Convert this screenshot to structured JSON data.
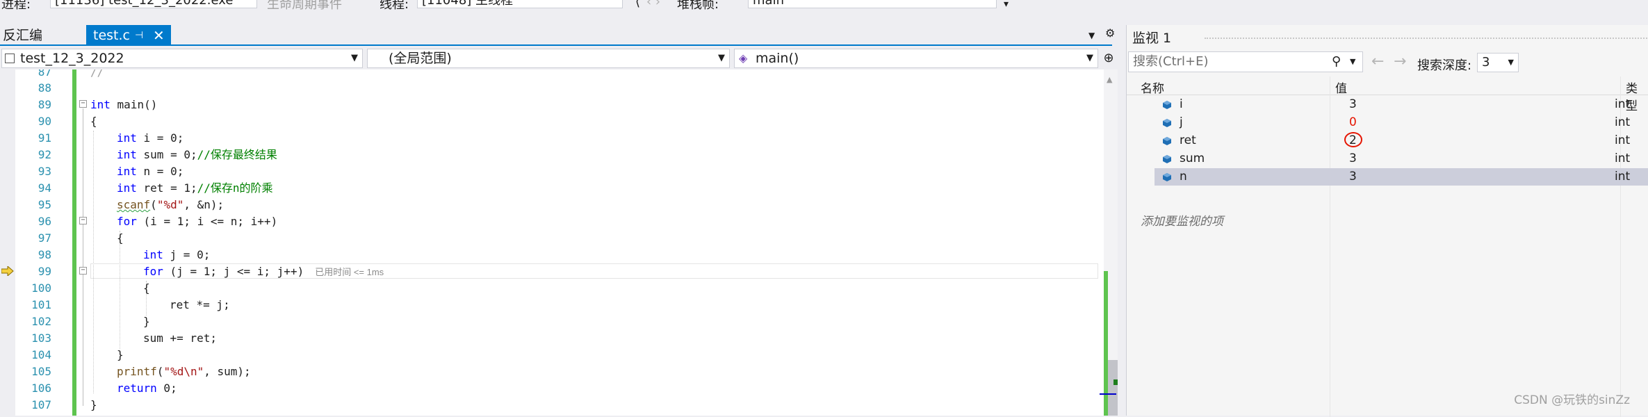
{
  "toolbar": {
    "process_label": "进程:",
    "process_value": "[11136] test_12_3_2022.exe",
    "lifecycle_label": "生命周期事件",
    "thread_label": "线程:",
    "thread_value": "[11048] 主线程",
    "stack_label": "堆栈帧:",
    "stack_value": "main"
  },
  "tabs": {
    "disassembly": "反汇编",
    "active": "test.c",
    "pin_glyph": "⊣",
    "close_glyph": "✕"
  },
  "navbar": {
    "project": "test_12_3_2022",
    "scope": "(全局范围)",
    "function": "main()"
  },
  "editor": {
    "lines": [
      {
        "n": "87",
        "text": "//"
      },
      {
        "n": "88",
        "text": ""
      },
      {
        "n": "89",
        "text": "int main()"
      },
      {
        "n": "90",
        "text": "{"
      },
      {
        "n": "91",
        "text": "int i = 0;"
      },
      {
        "n": "92",
        "text": "int sum = 0;//保存最终结果"
      },
      {
        "n": "93",
        "text": "int n = 0;"
      },
      {
        "n": "94",
        "text": "int ret = 1;//保存n的阶乘"
      },
      {
        "n": "95",
        "text": "scanf(\"%d\", &n);"
      },
      {
        "n": "96",
        "text": "for (i = 1; i <= n; i++)"
      },
      {
        "n": "97",
        "text": "{"
      },
      {
        "n": "98",
        "text": "int j = 0;"
      },
      {
        "n": "99",
        "text": "for (j = 1; j <= i; j++)"
      },
      {
        "n": "100",
        "text": "{"
      },
      {
        "n": "101",
        "text": "ret *= j;"
      },
      {
        "n": "102",
        "text": "}"
      },
      {
        "n": "103",
        "text": "sum += ret;"
      },
      {
        "n": "104",
        "text": "}"
      },
      {
        "n": "105",
        "text": "printf(\"%d\\n\", sum);"
      },
      {
        "n": "106",
        "text": "return 0;"
      },
      {
        "n": "107",
        "text": "}"
      }
    ],
    "elapsed": "已用时间 <= 1ms"
  },
  "watch": {
    "title": "监视 1",
    "search_placeholder": "搜索(Ctrl+E)",
    "search_depth_label": "搜索深度:",
    "search_depth_value": "3",
    "col_name": "名称",
    "col_value": "值",
    "col_type": "类型",
    "rows": [
      {
        "name": "i",
        "value": "3",
        "type": "int"
      },
      {
        "name": "j",
        "value": "0",
        "type": "int"
      },
      {
        "name": "ret",
        "value": "2",
        "type": "int"
      },
      {
        "name": "sum",
        "value": "3",
        "type": "int"
      },
      {
        "name": "n",
        "value": "3",
        "type": "int"
      }
    ],
    "add_watch": "添加要监视的项"
  },
  "colors": {
    "accent": "#007acc",
    "changed_value": "#e51400",
    "change_bar": "#5ec44f",
    "keyword": "#0000ff",
    "comment": "#008000"
  },
  "watermark": "CSDN @玩铁的sinZz"
}
